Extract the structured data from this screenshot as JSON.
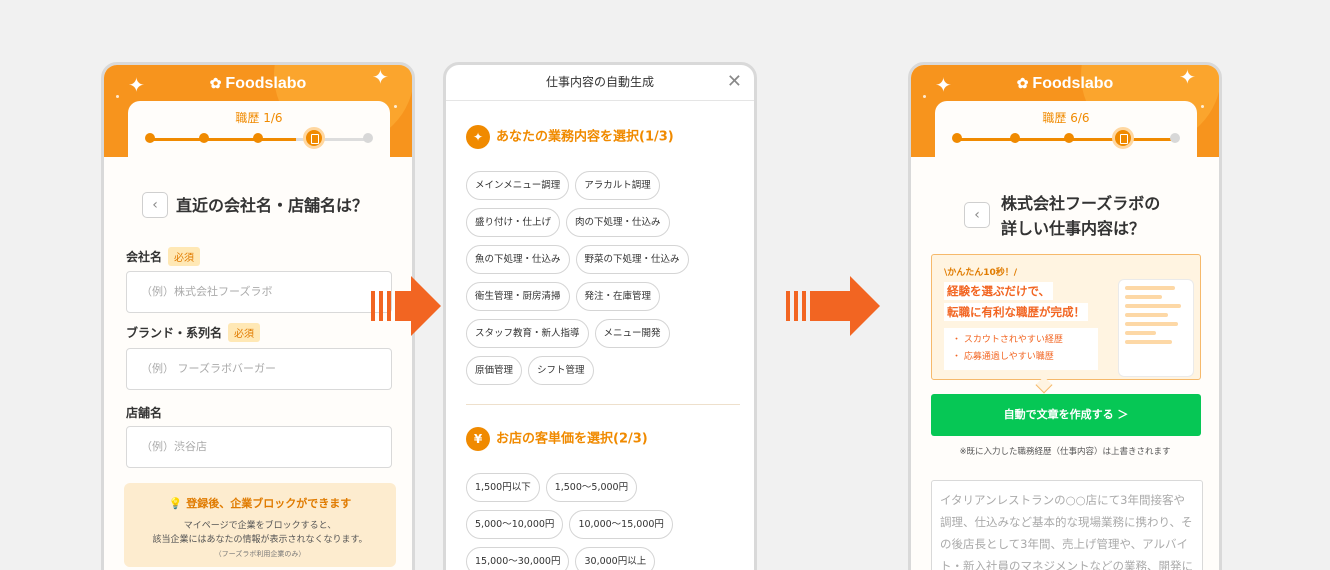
{
  "brand": {
    "logo": "Foodslabo",
    "accent": "#f7941d",
    "arrow_color": "#f26522",
    "cta_color": "#06c755"
  },
  "screen1": {
    "step": "職歴 1/6",
    "step_progress": 0.67,
    "question": "直近の会社名・店舗名は？",
    "required_label": "必須",
    "fields": [
      {
        "label": "会社名",
        "required": true,
        "placeholder": "（例）株式会社フーズラボ"
      },
      {
        "label": "ブランド・系列名",
        "required": true,
        "placeholder": "（例） フーズラボバーガー"
      },
      {
        "label": "店舗名",
        "required": false,
        "placeholder": "（例）渋谷店"
      }
    ],
    "notice": {
      "title": "登録後、企業ブロックができます",
      "line1": "マイページで企業をブロックすると、",
      "line2": "該当企業にはあなたの情報が表示されなくなります。",
      "small": "（フーズラボ利用企業のみ）"
    }
  },
  "screen2": {
    "title": "仕事内容の自動生成",
    "section1": {
      "title": "あなたの業務内容を選択(1/3)",
      "chips": [
        "メインメニュー調理",
        "アラカルト調理",
        "盛り付け・仕上げ",
        "肉の下処理・仕込み",
        "魚の下処理・仕込み",
        "野菜の下処理・仕込み",
        "衛生管理・厨房清掃",
        "発注・在庫管理",
        "スタッフ教育・新人指導",
        "メニュー開発",
        "原価管理",
        "シフト管理"
      ]
    },
    "section2": {
      "icon": "¥",
      "title": "お店の客単価を選択(2/3)",
      "chips": [
        "1,500円以下",
        "1,500〜5,000円",
        "5,000〜10,000円",
        "10,000〜15,000円",
        "15,000〜30,000円",
        "30,000円以上"
      ]
    }
  },
  "screen3": {
    "step": "職歴 6/6",
    "step_progress": 1.0,
    "question_line1": "株式会社フーズラボの",
    "question_line2": "詳しい仕事内容は？",
    "promo": {
      "pre": "\\かんたん10秒！/",
      "headline1": "経験を選ぶだけで、",
      "headline2": "転職に有利な職歴が完成！",
      "bullet1": "・ スカウトされやすい経歴",
      "bullet2": "・ 応募通過しやすい職歴"
    },
    "cta": "自動で文章を作成する ＞",
    "note": "※既に入力した職務経歴（仕事内容）は上書きされます",
    "textarea_placeholder": "イタリアンレストランの○○店にて3年間接客や調理、仕込みなど基本的な現場業務に携わり、その後店長として3年間、売上げ管理や、アルバイト・新入社員のマネジメントなどの業務、開発に携"
  }
}
